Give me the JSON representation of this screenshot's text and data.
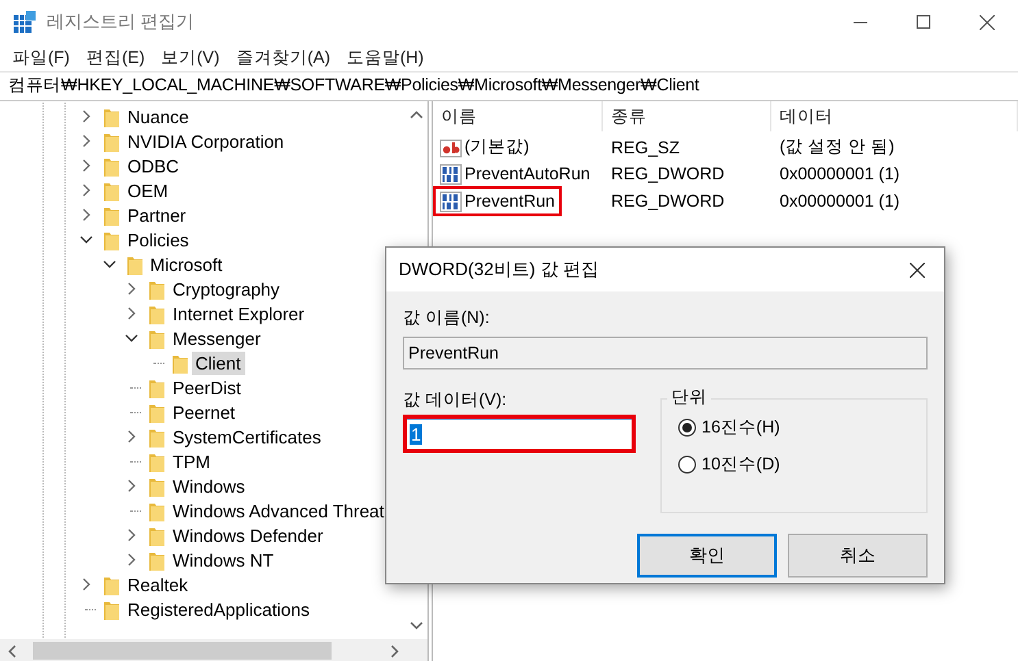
{
  "window": {
    "title": "레지스트리 편집기"
  },
  "menu": [
    "파일(F)",
    "편집(E)",
    "보기(V)",
    "즐겨찾기(A)",
    "도움말(H)"
  ],
  "address": "컴퓨터₩HKEY_LOCAL_MACHINE₩SOFTWARE₩Policies₩Microsoft₩Messenger₩Client",
  "tree": {
    "items": [
      {
        "label": "Nuance",
        "expandable": true,
        "expanded": false,
        "selected": false
      },
      {
        "label": "NVIDIA Corporation",
        "expandable": true,
        "expanded": false,
        "selected": false
      },
      {
        "label": "ODBC",
        "expandable": true,
        "expanded": false,
        "selected": false
      },
      {
        "label": "OEM",
        "expandable": true,
        "expanded": false,
        "selected": false
      },
      {
        "label": "Partner",
        "expandable": true,
        "expanded": false,
        "selected": false
      },
      {
        "label": "Policies",
        "expandable": true,
        "expanded": true,
        "selected": false,
        "children": [
          {
            "label": "Microsoft",
            "expandable": true,
            "expanded": true,
            "selected": false,
            "children": [
              {
                "label": "Cryptography",
                "expandable": true,
                "expanded": false,
                "selected": false
              },
              {
                "label": "Internet Explorer",
                "expandable": true,
                "expanded": false,
                "selected": false
              },
              {
                "label": "Messenger",
                "expandable": true,
                "expanded": true,
                "selected": false,
                "children": [
                  {
                    "label": "Client",
                    "expandable": false,
                    "expanded": false,
                    "selected": true
                  }
                ]
              },
              {
                "label": "PeerDist",
                "expandable": false,
                "expanded": false,
                "selected": false
              },
              {
                "label": "Peernet",
                "expandable": false,
                "expanded": false,
                "selected": false
              },
              {
                "label": "SystemCertificates",
                "expandable": true,
                "expanded": false,
                "selected": false
              },
              {
                "label": "TPM",
                "expandable": false,
                "expanded": false,
                "selected": false
              },
              {
                "label": "Windows",
                "expandable": true,
                "expanded": false,
                "selected": false
              },
              {
                "label": "Windows Advanced Threat",
                "expandable": false,
                "expanded": false,
                "selected": false
              },
              {
                "label": "Windows Defender",
                "expandable": true,
                "expanded": false,
                "selected": false
              },
              {
                "label": "Windows NT",
                "expandable": true,
                "expanded": false,
                "selected": false
              }
            ]
          }
        ]
      },
      {
        "label": "Realtek",
        "expandable": true,
        "expanded": false,
        "selected": false
      },
      {
        "label": "RegisteredApplications",
        "expandable": false,
        "expanded": false,
        "selected": false
      }
    ]
  },
  "list": {
    "columns": [
      "이름",
      "종류",
      "데이터"
    ],
    "rows": [
      {
        "kind": "string",
        "name": "(기본값)",
        "type": "REG_SZ",
        "data": "(값 설정 안 됨)",
        "highlighted": false
      },
      {
        "kind": "dword",
        "name": "PreventAutoRun",
        "type": "REG_DWORD",
        "data": "0x00000001 (1)",
        "highlighted": false
      },
      {
        "kind": "dword",
        "name": "PreventRun",
        "type": "REG_DWORD",
        "data": "0x00000001 (1)",
        "highlighted": true
      }
    ]
  },
  "dialog": {
    "title": "DWORD(32비트) 값 편집",
    "name_label": "값 이름(N):",
    "name_value": "PreventRun",
    "data_label": "값 데이터(V):",
    "data_value": "1",
    "data_highlighted": true,
    "base": {
      "label": "단위",
      "options": [
        {
          "label": "16진수(H)",
          "selected": true
        },
        {
          "label": "10진수(D)",
          "selected": false
        }
      ]
    },
    "buttons": [
      {
        "label": "확인",
        "default": true
      },
      {
        "label": "취소",
        "default": false
      }
    ]
  }
}
